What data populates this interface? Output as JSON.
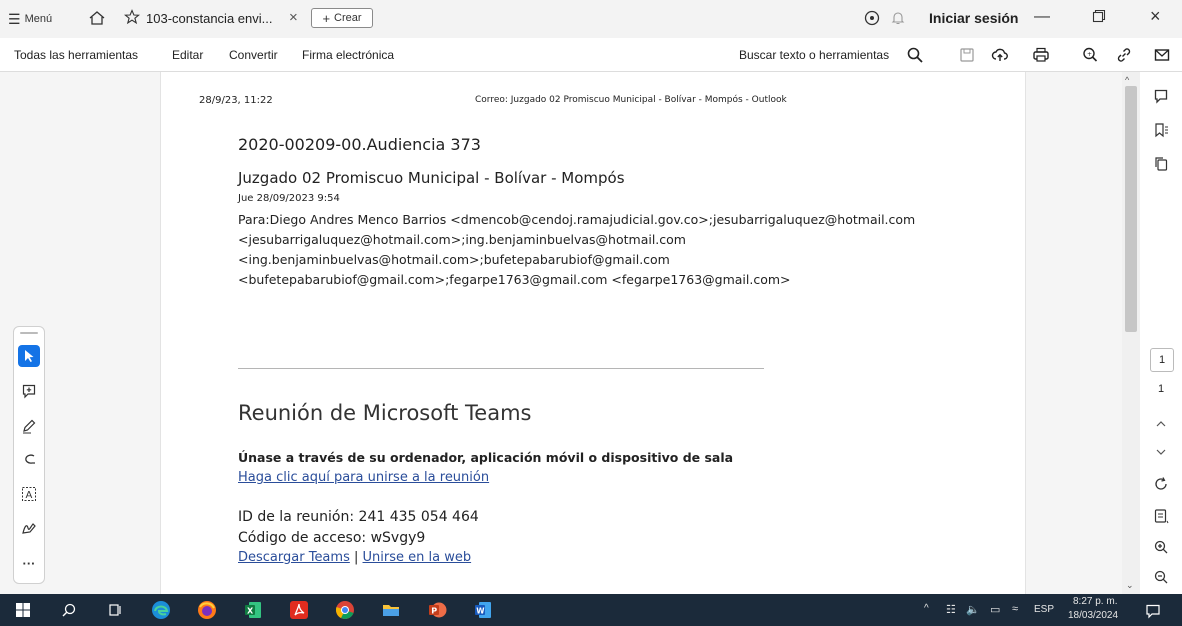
{
  "titlebar": {
    "menu_label": "Menú",
    "tab_title": "103-constancia envi...",
    "tab_close": "×",
    "create_label": "Crear",
    "signin_label": "Iniciar sesión"
  },
  "menubar": {
    "items": [
      "Todas las herramientas",
      "Editar",
      "Convertir",
      "Firma electrónica"
    ],
    "search_label": "Buscar texto o herramientas"
  },
  "document": {
    "header_date": "28/9/23, 11:22",
    "header_title": "Correo: Juzgado 02 Promiscuo Municipal - Bolívar - Mompós - Outlook",
    "subject": "2020-00209-00.Audiencia 373",
    "sender": "Juzgado 02 Promiscuo Municipal - Bolívar - Mompós",
    "sent_date": "Jue 28/09/2023 9:54",
    "recipients": [
      "Para:Diego Andres Menco Barrios <dmencob@cendoj.ramajudicial.gov.co>;jesubarrigaluquez@hotmail.com",
      "<jesubarrigaluquez@hotmail.com>;ing.benjaminbuelvas@hotmail.com",
      "<ing.benjaminbuelvas@hotmail.com>;bufetepabarubiof@gmail.com",
      "<bufetepabarubiof@gmail.com>;fegarpe1763@gmail.com <fegarpe1763@gmail.com>"
    ],
    "teams_heading": "Reunión de Microsoft Teams",
    "join_text": "Únase a través de su ordenador, aplicación móvil o dispositivo de sala",
    "join_link": "Haga clic aquí para unirse a la reunión",
    "meeting_id": "ID de la reunión: 241 435 054 464",
    "access_code": "Código de acceso: wSvgy9",
    "download_link": "Descargar Teams",
    "separator": "|",
    "web_link": "Unirse en la web"
  },
  "rightpanel": {
    "page_input": "1",
    "page_total": "1"
  },
  "taskbar": {
    "language": "ESP",
    "time": "8:27 p. m.",
    "date": "18/03/2024"
  },
  "colors": {
    "link": "#2a4d9a",
    "taskbar": "#1b2a3a",
    "active_tool": "#1473e6"
  }
}
